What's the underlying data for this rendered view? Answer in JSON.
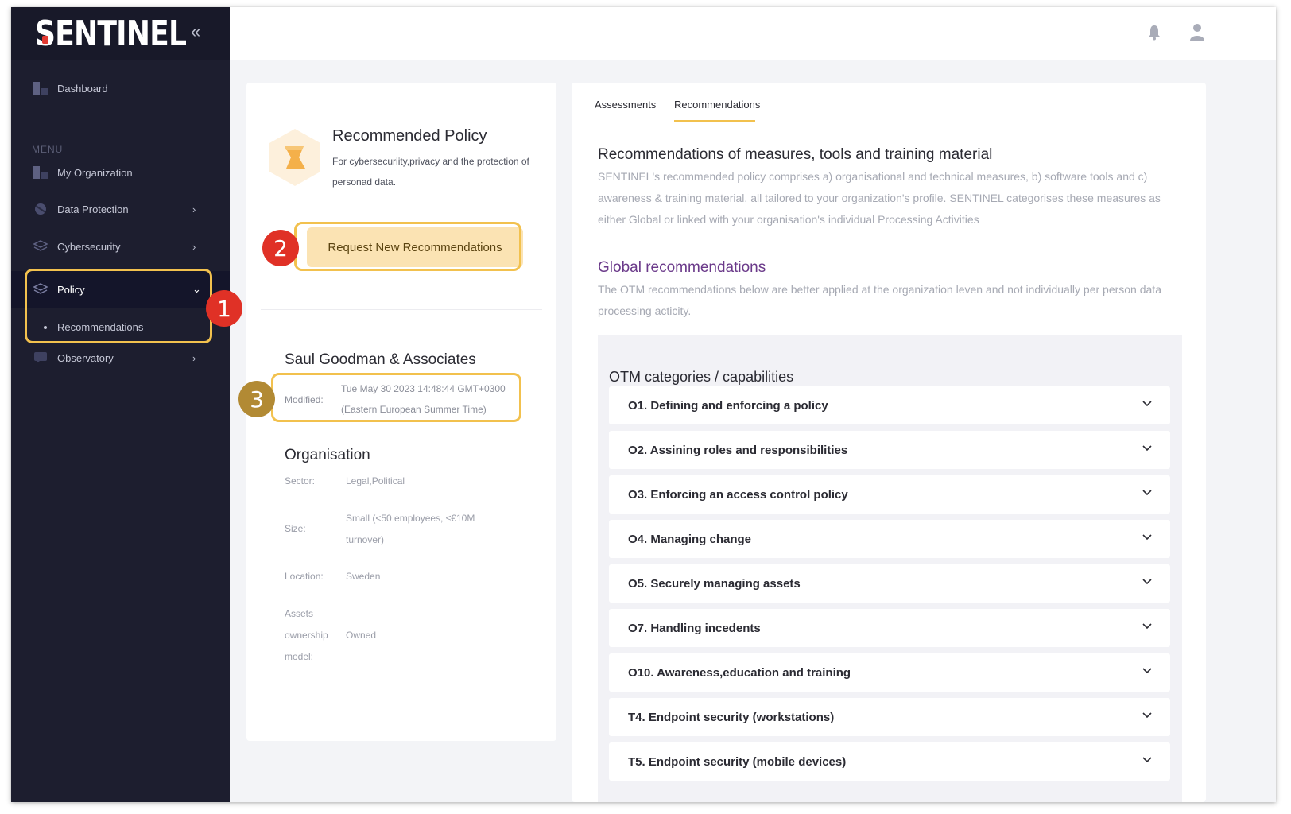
{
  "app": {
    "logo_text": "SENTINEL",
    "collapse_icon": "double-chevron-left-icon"
  },
  "sidebar": {
    "menu_label": "MENU",
    "items": [
      {
        "label": "Dashboard",
        "icon": "dashboard-icon"
      },
      {
        "label": "My Organization",
        "icon": "organization-icon"
      },
      {
        "label": "Data Protection",
        "icon": "data-protection-icon"
      },
      {
        "label": "Cybersecurity",
        "icon": "cybersecurity-icon"
      },
      {
        "label": "Policy",
        "icon": "policy-icon"
      },
      {
        "label": "Observatory",
        "icon": "observatory-icon"
      }
    ],
    "sub_items": [
      {
        "label": "Recommendations"
      }
    ]
  },
  "badges": {
    "one": "1",
    "two": "2",
    "three": "3"
  },
  "policy_card": {
    "title": "Recommended Policy",
    "subtitle": "For cybersecuriity,privacy and the protection of personad data.",
    "request_button": "Request New Recommendations",
    "organization_name": "Saul Goodman & Associates",
    "modified_label": "Modified:",
    "modified_value": "Tue May 30 2023 14:48:44 GMT+0300 (Eastern European Summer Time)",
    "org_section_title": "Organisation",
    "fields": [
      {
        "label": "Sector:",
        "value": "Legal,Political"
      },
      {
        "label": "Size:",
        "value": "Small (<50 employees, ≤€10M turnover)"
      },
      {
        "label": "Location:",
        "value": "Sweden"
      },
      {
        "label": "Assets ownership model:",
        "value": "Owned"
      }
    ]
  },
  "tabs": [
    {
      "label": "Assessments",
      "active": false
    },
    {
      "label": "Recommendations",
      "active": true
    }
  ],
  "recommendations": {
    "title": "Recommendations of measures, tools and training material",
    "description": "SENTINEL's recommended policy comprises a) organisational and technical measures, b) software tools and c) awareness & training material, all tailored to your organization's profile. SENTINEL categorises these measures as either Global or linked with your organisation's individual Processing Activities",
    "global_title": "Global recommendations",
    "global_description": "The OTM recommendations below are better applied at the organization leven and not individually per person data processing acticity.",
    "otm_title": "OTM categories / capabilities",
    "otm_items": [
      "O1. Defining and enforcing a policy",
      "O2. Assining roles and responsibilities",
      "O3. Enforcing an access control policy",
      "O4. Managing change",
      "O5. Securely managing assets",
      "O7. Handling incedents",
      "O10. Awareness,education and training",
      "T4. Endpoint security (workstations)",
      "T5. Endpoint security (mobile devices)"
    ]
  },
  "colors": {
    "sidebar_bg": "#1d1e2f",
    "accent_gold": "#f2c14e",
    "badge_red": "#e03126",
    "badge_gold": "#b28a34",
    "global_title": "#6b3a8a"
  },
  "header_icons": [
    "bell-icon",
    "user-icon"
  ]
}
